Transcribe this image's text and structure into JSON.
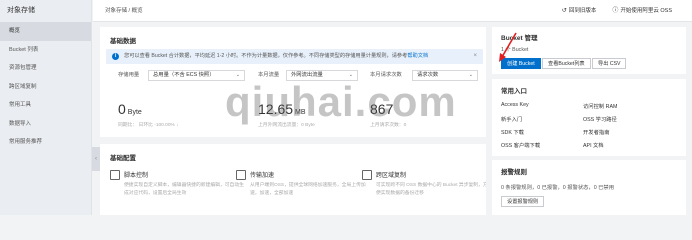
{
  "sidebar": {
    "title": "对象存储",
    "items": [
      {
        "label": "概览",
        "active": true
      },
      {
        "label": "Bucket 列表"
      },
      {
        "label": "资源包管理"
      },
      {
        "label": "跨区域复制"
      },
      {
        "label": "常用工具"
      },
      {
        "label": "数据导入"
      },
      {
        "label": "常用服务推荐"
      }
    ]
  },
  "topbar": {
    "breadcrumb": "对象存储 / 概览",
    "links": [
      "回到旧版本",
      "开始使用阿里云 OSS"
    ]
  },
  "basic_data": {
    "title": "基础数据",
    "notice": "您可以查看 Bucket 合计数据，平均延迟 1-2 小时。不作为计量数据，仅作参考。不同存储类型的存储用量计量规则，请参考",
    "notice_link": "帮助文档",
    "filters": [
      {
        "label": "存储用量",
        "value": "总用量（不含 ECS 快照）"
      },
      {
        "label": "本月流量",
        "value": "外网流出流量"
      },
      {
        "label": "本月请求次数",
        "value": "请求次数"
      }
    ],
    "metrics": [
      {
        "value": "0",
        "unit": "Byte",
        "sub": "同期比：  日环比 -100.00% ↓"
      },
      {
        "value": "12.65",
        "unit": "MB",
        "sub": "上月外网流出流量：0 Byte"
      },
      {
        "value": "867",
        "unit": "",
        "sub": "上月请求次数：0"
      }
    ]
  },
  "basic_config": {
    "title": "基础配置",
    "features": [
      {
        "icon": "script-icon",
        "title": "脚本控制",
        "desc": "便捷实现自定义脚本，编辑器快捷的新建编辑，可自动生成对应代码，设置后全局生效"
      },
      {
        "icon": "transfer-icon",
        "title": "传输加速",
        "desc": "从用户端到OSS，提供全球网络加速服务，全局上传加速，加速，全部加速"
      },
      {
        "icon": "cross-region-icon",
        "title": "跨区域复制",
        "desc": "可实现跨不同 OSS 数据中心的 Bucket 异步复制，方便实现数据的备份迁移"
      }
    ]
  },
  "bucket_mgmt": {
    "title": "Bucket 管理",
    "count": "1 个 Bucket",
    "buttons": [
      "创建 Bucket",
      "查看Bucket列表",
      "导出 CSV"
    ]
  },
  "common_entry": {
    "title": "常用入口",
    "links": [
      "Access Key",
      "访问控制 RAM",
      "新手入门",
      "OSS 学习路径",
      "SDK 下载",
      "开发者指南",
      "OSS 客户端下载",
      "API 文档"
    ]
  },
  "alert_rules": {
    "title": "报警规则",
    "summary": "0 条报警规则，0 已报警，0 报警状态，0 已禁用",
    "button": "设置报警规则"
  },
  "watermark": "qiuhai.com",
  "colors": {
    "primary": "#0070cc",
    "annotation_arrow": "#e02020"
  }
}
